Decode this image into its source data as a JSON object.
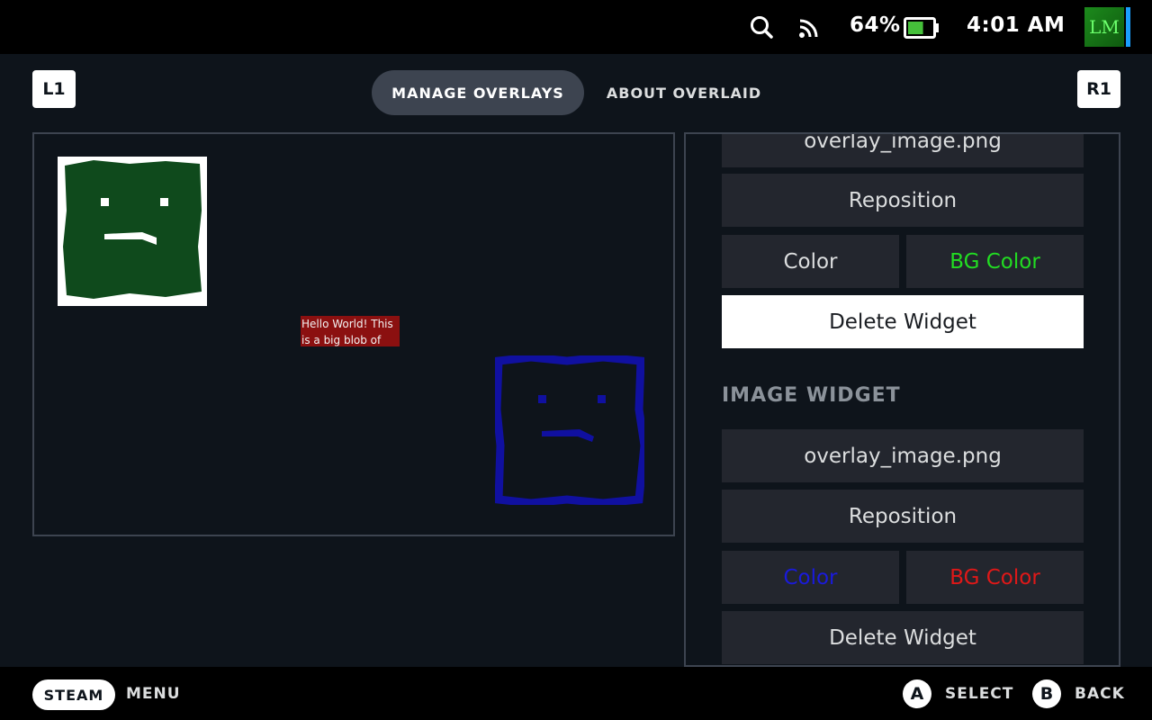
{
  "status": {
    "battery_percent": "64%",
    "battery_level": 0.64,
    "time": "4:01 AM",
    "avatar_initials": "LM"
  },
  "header": {
    "left_shoulder": "L1",
    "right_shoulder": "R1",
    "tabs": [
      {
        "label": "MANAGE OVERLAYS",
        "active": true
      },
      {
        "label": "ABOUT OVERLAID",
        "active": false
      }
    ]
  },
  "preview": {
    "text_widget": "Hello World! This is a big blob of",
    "text_widget_bg": "#8b1010",
    "image_widgets": [
      {
        "color": "#ffffff",
        "bg": "#0f4a1c"
      },
      {
        "color": "#1010a0",
        "bg": "#0e141b"
      }
    ]
  },
  "settings": {
    "text_widget": {
      "filename": "overlay_image.png",
      "reposition": "Reposition",
      "color": "Color",
      "bg_color": "BG Color",
      "color_hex": "#dcdedf",
      "bg_color_hex": "#22dd22",
      "delete": "Delete Widget"
    },
    "image_widget": {
      "title": "IMAGE WIDGET",
      "filename": "overlay_image.png",
      "reposition": "Reposition",
      "color": "Color",
      "bg_color": "BG Color",
      "color_hex": "#1a1adc",
      "bg_color_hex": "#e01818",
      "delete": "Delete Widget"
    }
  },
  "footer": {
    "steam": "STEAM",
    "menu": "MENU",
    "a_button": "A",
    "select": "SELECT",
    "b_button": "B",
    "back": "BACK"
  }
}
